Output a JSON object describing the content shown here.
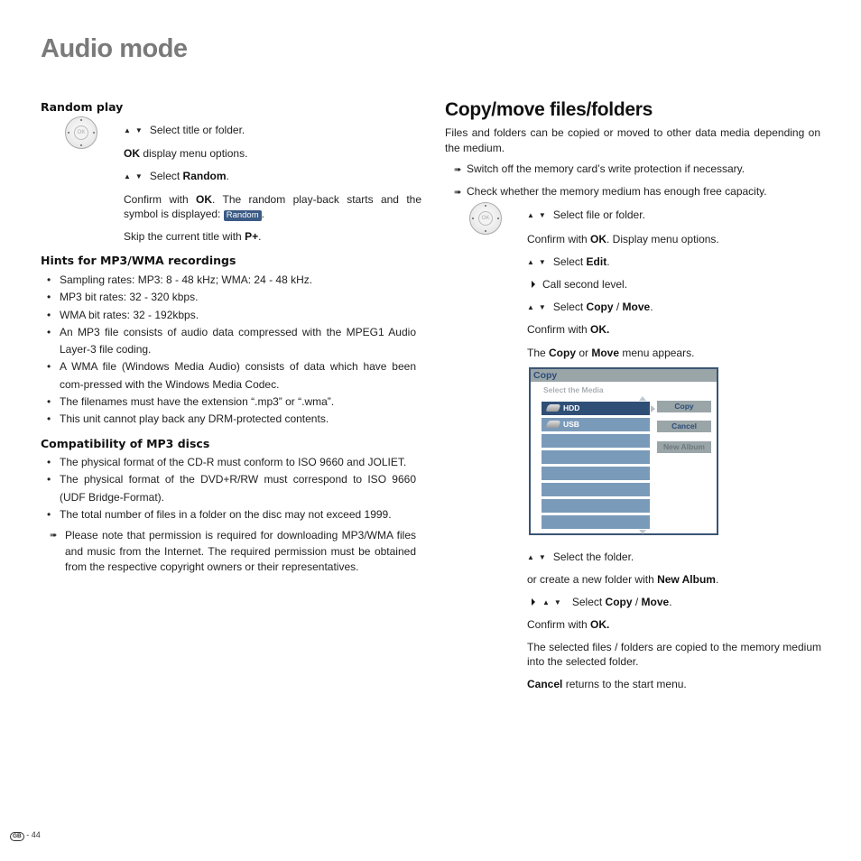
{
  "page": {
    "title": "Audio mode",
    "footer": {
      "region_badge": "GB",
      "page_number": "- 44"
    }
  },
  "left": {
    "random_play": {
      "heading": "Random play",
      "steps": [
        {
          "icon": "up-down-arrows",
          "text": "Select title or folder."
        },
        {
          "bold": "OK",
          "text": " display menu options."
        },
        {
          "icon": "up-down-arrows",
          "text": "Select ",
          "bold_after": "Random",
          "tail": "."
        },
        {
          "pre": "Confirm with ",
          "bold": "OK",
          "text": ". The random play-back starts and the symbol is displayed: ",
          "badge": "Random",
          "tail": "."
        },
        {
          "pre": "Skip the current title with ",
          "bold": "P+",
          "tail": "."
        }
      ]
    },
    "hints": {
      "heading": "Hints for MP3/WMA recordings",
      "items": [
        "Sampling rates: MP3: 8 - 48 kHz; WMA: 24 - 48 kHz.",
        "MP3 bit rates: 32 - 320 kbps.",
        "WMA bit rates: 32 - 192kbps.",
        "An MP3 file consists of audio data compressed with the MPEG1 Audio Layer-3 file coding.",
        "A WMA file (Windows Media Audio) consists of data which have been com-pressed with the Windows Media Codec.",
        "The filenames must have the extension “.mp3” or “.wma”.",
        "This unit cannot play back any DRM-protected contents."
      ]
    },
    "compat": {
      "heading": "Compatibility of MP3 discs",
      "items": [
        "The physical format of the CD-R must conform to ISO 9660 and JOLIET.",
        "The physical format of the DVD+R/RW must correspond to ISO 9660 (UDF Bridge-Format).",
        "The total number of files in a folder on the disc may not exceed 1999."
      ],
      "note": "Please note that permission is required for downloading MP3/WMA files and music from the Internet. The required permission must be obtained from the respective copyright owners or their representatives."
    }
  },
  "right": {
    "heading": "Copy/move files/folders",
    "intro": "Files and folders can be copied or moved to other data media depending on the medium.",
    "notes": [
      "Switch off the memory card’s write protection if necessary.",
      "Check whether the memory medium has enough free capacity."
    ],
    "steps": {
      "s1": "Select file or folder.",
      "s2_pre": "Confirm with ",
      "s2_bold": "OK",
      "s2_text": ". Display menu options.",
      "s3_pre": "Select ",
      "s3_bold": "Edit",
      "s3_tail": ".",
      "s4": "Call second level.",
      "s5_pre": "Select ",
      "s5_b1": "Copy",
      "s5_sep": " / ",
      "s5_b2": "Move",
      "s5_tail": ".",
      "s6_pre": "Confirm with ",
      "s6_bold": "OK.",
      "s7_pre": "The ",
      "s7_b1": "Copy",
      "s7_mid": " or ",
      "s7_b2": "Move",
      "s7_tail": " menu appears.",
      "s8": "Select the folder.",
      "s9_pre": "or create a new folder with ",
      "s9_bold": "New Album",
      "s9_tail": ".",
      "s10_pre": "Select ",
      "s10_b1": "Copy",
      "s10_sep": " / ",
      "s10_b2": "Move",
      "s10_tail": ".",
      "s11_pre": "Confirm with ",
      "s11_bold": "OK.",
      "s12": "The selected files / folders are copied to the memory medium into the selected folder.",
      "s13_bold": "Cancel",
      "s13_text": " returns to the start menu."
    },
    "menu": {
      "title": "Copy",
      "subtitle": "Select the Media",
      "media": [
        {
          "label": "HDD",
          "selected": true
        },
        {
          "label": "USB",
          "selected": false
        },
        {
          "label": ""
        },
        {
          "label": ""
        },
        {
          "label": ""
        },
        {
          "label": ""
        },
        {
          "label": ""
        },
        {
          "label": ""
        }
      ],
      "buttons": [
        {
          "label": "Copy",
          "enabled": true
        },
        {
          "label": "Cancel",
          "enabled": true
        },
        {
          "label": "New Album",
          "enabled": false
        }
      ],
      "colors": {
        "frame": "#3a5575",
        "selected": "#2f4f77",
        "row": "#7a9aba",
        "button": "#9aa5a8"
      }
    },
    "badge_color": "#3b5b85"
  }
}
